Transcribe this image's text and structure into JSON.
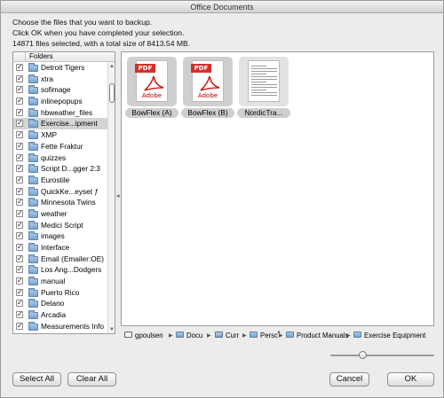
{
  "window": {
    "title": "Office Documents"
  },
  "instructions": {
    "line1": "Choose the files that you want to backup.",
    "line2": "Click OK when you have completed your selection.",
    "line3": "14871 files selected, with a total size of 8413.54 MB."
  },
  "folders": {
    "header": "Folders",
    "check_mark": "✓",
    "items": [
      {
        "label": "Detroit Tigers",
        "checked": true
      },
      {
        "label": "xtra",
        "checked": true
      },
      {
        "label": "sofimage",
        "checked": true
      },
      {
        "label": "inlinepopups",
        "checked": true
      },
      {
        "label": "hbweather_files",
        "checked": true
      },
      {
        "label": "Exercise...ipment",
        "checked": true,
        "selected": true
      },
      {
        "label": "XMP",
        "checked": true
      },
      {
        "label": "Fette Fraktur",
        "checked": true
      },
      {
        "label": "quizzes",
        "checked": true
      },
      {
        "label": "Script D...gger 2:3",
        "checked": true
      },
      {
        "label": "Eurostile",
        "checked": true
      },
      {
        "label": "QuickKe...eyset ƒ",
        "checked": true
      },
      {
        "label": "Minnesota Twins",
        "checked": true
      },
      {
        "label": "weather",
        "checked": true
      },
      {
        "label": "Medici Script",
        "checked": true
      },
      {
        "label": "images",
        "checked": true
      },
      {
        "label": "Interface",
        "checked": true
      },
      {
        "label": "Email (Emailer:OE)",
        "checked": true
      },
      {
        "label": "Los Ang...Dodgers",
        "checked": true
      },
      {
        "label": "manual",
        "checked": true
      },
      {
        "label": "Puerto Rico",
        "checked": true
      },
      {
        "label": "Delano",
        "checked": true
      },
      {
        "label": "Arcadia",
        "checked": true
      },
      {
        "label": "Measurements Info",
        "checked": true
      }
    ]
  },
  "files": [
    {
      "label": "BowFlex (A)",
      "badge": "PDF",
      "brand": "Adobe",
      "icon": "pdf-icon"
    },
    {
      "label": "BowFlex (B)",
      "badge": "PDF",
      "brand": "Adobe",
      "icon": "pdf-icon"
    },
    {
      "label": "NordicTra...",
      "icon": "document-thumbnail-icon"
    }
  ],
  "path": {
    "items": [
      {
        "label": "gpoulsen",
        "icon": "home-icon"
      },
      {
        "label": "Docu",
        "icon": "folder-icon"
      },
      {
        "label": "Curr",
        "icon": "drive-icon"
      },
      {
        "label": "Persc",
        "icon": "folder-icon"
      },
      {
        "label": "Product Manuals",
        "icon": "folder-icon"
      },
      {
        "label": "Exercise Equipment",
        "icon": "folder-icon"
      }
    ],
    "separator": "▶"
  },
  "zoom": {
    "level": 0.3
  },
  "buttons": {
    "select_all": "Select All",
    "clear_all": "Clear All",
    "cancel": "Cancel",
    "ok": "OK"
  }
}
